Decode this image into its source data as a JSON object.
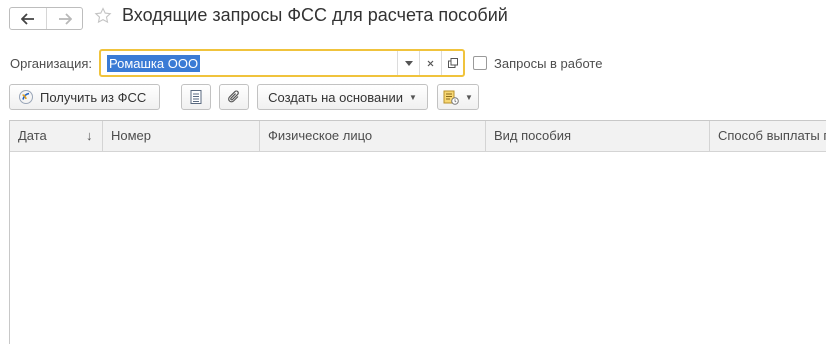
{
  "window": {
    "title": "Входящие запросы ФСС для расчета пособий"
  },
  "nav": {
    "back_icon": "arrow-left-icon",
    "forward_icon": "arrow-right-icon",
    "favorite_icon": "star-icon"
  },
  "filter": {
    "organization_label": "Организация:",
    "organization_value": "Ромашка ООО",
    "in_work_label": "Запросы в работе",
    "in_work_checked": false
  },
  "toolbar": {
    "get_from_fss_label": "Получить из ФСС",
    "list_icon": "list-icon",
    "attachment_icon": "paperclip-icon",
    "create_based_on_label": "Создать на основании",
    "report_icon": "report-icon"
  },
  "table": {
    "columns": [
      "Дата",
      "Номер",
      "Физическое лицо",
      "Вид пособия",
      "Способ выплаты пособия"
    ],
    "sort_indicator": "↓",
    "rows": []
  },
  "colors": {
    "focus_border": "#f0c33c",
    "selection": "#3a7bd5"
  }
}
